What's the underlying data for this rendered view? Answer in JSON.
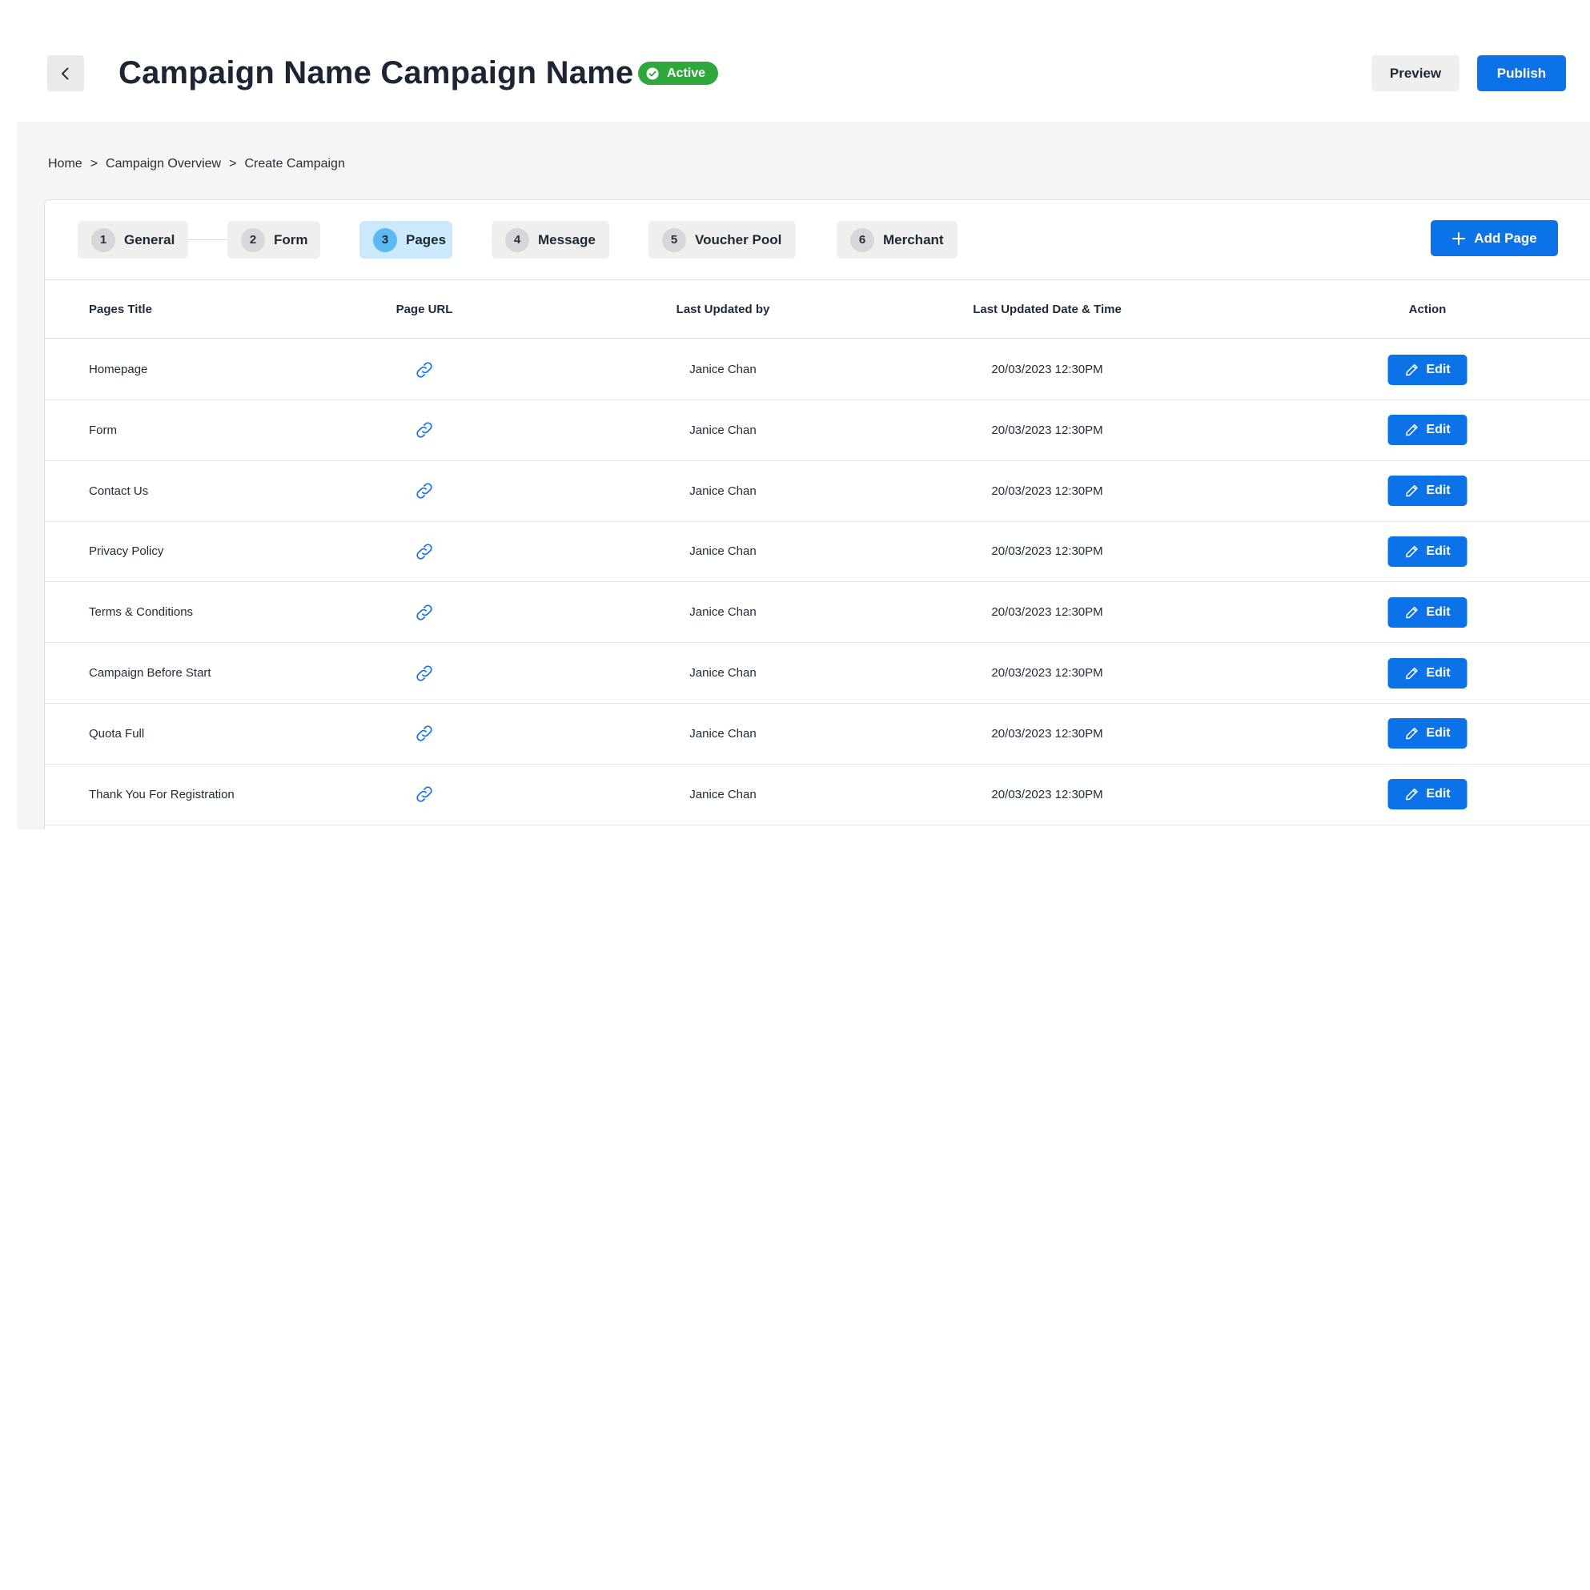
{
  "header": {
    "title": "Campaign Name Campaign Name",
    "status": "Active",
    "preview_label": "Preview",
    "publish_label": "Publish"
  },
  "breadcrumb": {
    "items": [
      "Home",
      "Campaign Overview",
      "Create Campaign"
    ],
    "separator": ">"
  },
  "stepper": {
    "steps": [
      {
        "num": "1",
        "label": "General"
      },
      {
        "num": "2",
        "label": "Form"
      },
      {
        "num": "3",
        "label": "Pages"
      },
      {
        "num": "4",
        "label": "Message"
      },
      {
        "num": "5",
        "label": "Voucher Pool"
      },
      {
        "num": "6",
        "label": "Merchant"
      }
    ],
    "active_step": "Pages"
  },
  "add_page_label": "Add Page",
  "table": {
    "columns": [
      "Pages Title",
      "Page URL",
      "Last Updated by",
      "Last Updated Date & Time",
      "Action"
    ],
    "rows": [
      {
        "title": "Homepage",
        "updated_by": "Janice Chan",
        "updated_at": "20/03/2023 12:30PM",
        "action": "Edit"
      },
      {
        "title": "Form",
        "updated_by": "Janice Chan",
        "updated_at": "20/03/2023 12:30PM",
        "action": "Edit"
      },
      {
        "title": "Contact Us",
        "updated_by": "Janice Chan",
        "updated_at": "20/03/2023 12:30PM",
        "action": "Edit"
      },
      {
        "title": "Privacy Policy",
        "updated_by": "Janice Chan",
        "updated_at": "20/03/2023 12:30PM",
        "action": "Edit"
      },
      {
        "title": "Terms & Conditions",
        "updated_by": "Janice Chan",
        "updated_at": "20/03/2023 12:30PM",
        "action": "Edit"
      },
      {
        "title": "Campaign Before Start",
        "updated_by": "Janice Chan",
        "updated_at": "20/03/2023 12:30PM",
        "action": "Edit"
      },
      {
        "title": "Quota Full",
        "updated_by": "Janice Chan",
        "updated_at": "20/03/2023 12:30PM",
        "action": "Edit"
      },
      {
        "title": "Thank You For Registration",
        "updated_by": "Janice Chan",
        "updated_at": "20/03/2023 12:30PM",
        "action": "Edit"
      }
    ]
  },
  "icons": {
    "back": "chevron-left-icon",
    "status": "check-circle-icon",
    "add": "plus-icon",
    "url": "link-icon",
    "edit": "pencil-icon"
  },
  "colors": {
    "primary": "#0b72e8",
    "active_status": "#2ea83a",
    "active_step_bg": "#cbe9fb",
    "active_step_num": "#5cb9f2",
    "link_icon": "#1a73e8"
  }
}
